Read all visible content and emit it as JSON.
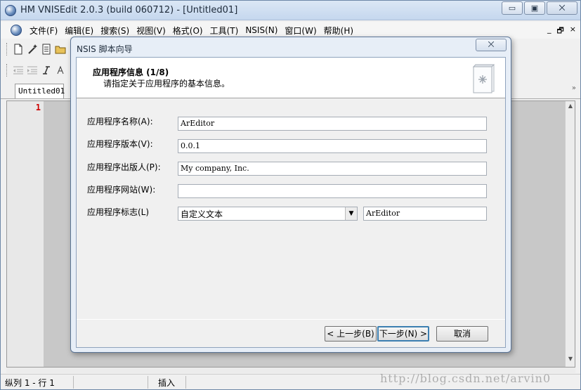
{
  "window": {
    "title": "HM VNISEdit 2.0.3 (build 060712) - [Untitled01]",
    "minimize": "▭",
    "maximize": "▣",
    "close": "⨉"
  },
  "menu": {
    "items": [
      "文件(F)",
      "编辑(E)",
      "搜索(S)",
      "视图(V)",
      "格式(O)",
      "工具(T)",
      "NSIS(N)",
      "窗口(W)",
      "帮助(H)"
    ],
    "mdi_min": "_",
    "mdi_restore": "🗗",
    "mdi_close": "×"
  },
  "toolbar": {
    "icons_row1": [
      "new-file-icon",
      "magic-wand-icon",
      "script-icon",
      "open-folder-icon"
    ],
    "icons_row2": [
      "outdent-icon",
      "indent-icon",
      "italic-icon",
      "font-icon"
    ]
  },
  "tabs": {
    "doc_tab": "Untitled01",
    "scroll_hint": "»"
  },
  "editor": {
    "line_number": "1"
  },
  "status": {
    "position": "纵列 1 - 行 1",
    "mode": "插入",
    "watermark": "http://blog.csdn.net/arvin0"
  },
  "dialog": {
    "title": "NSIS 脚本向导",
    "close": "⨉",
    "header_title": "应用程序信息 (1/8)",
    "header_subtitle": "请指定关于应用程序的基本信息。",
    "fields": {
      "name_label": "应用程序名称(A):",
      "name_value": "ArEditor",
      "version_label": "应用程序版本(V):",
      "version_value": "0.0.1",
      "publisher_label": "应用程序出版人(P):",
      "publisher_value": "My company, Inc.",
      "website_label": "应用程序网站(W):",
      "website_value": "",
      "brand_label": "应用程序标志(L)",
      "brand_select": "自定义文本",
      "brand_text": "ArEditor"
    },
    "buttons": {
      "back": "< 上一步(B)",
      "next": "下一步(N) >",
      "cancel": "取消"
    }
  },
  "colors": {
    "line_number": "#cc0000",
    "default_button_border": "#3c7fb1",
    "dialog_frame": "#e7eef7"
  }
}
